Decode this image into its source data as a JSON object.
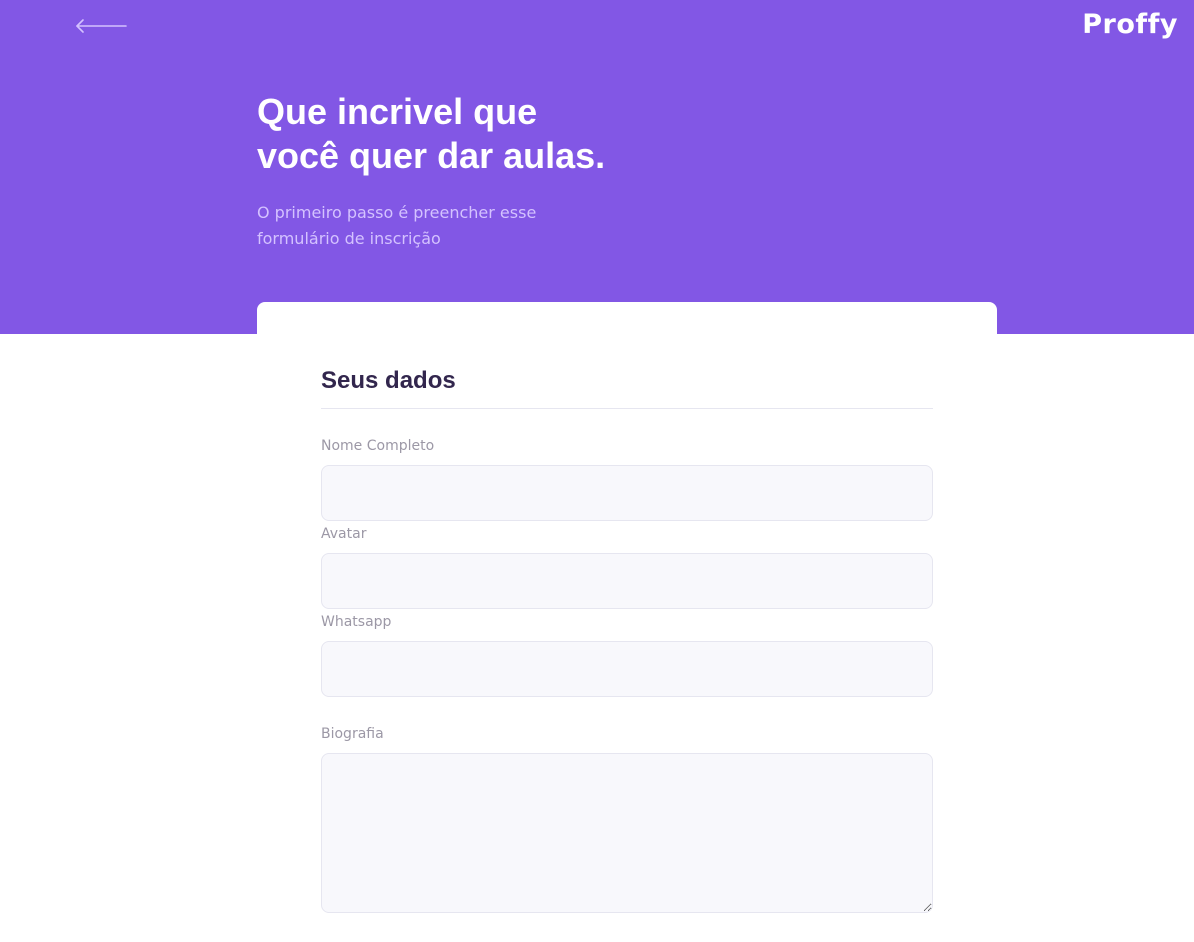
{
  "header": {
    "logo": "Proffy",
    "title_line1": "Que incrivel que",
    "title_line2": "você quer dar aulas.",
    "subtitle_line1": "O primeiro passo é preencher esse",
    "subtitle_line2": "formulário de inscrição",
    "back_icon": "arrow-left-icon",
    "background_color": "#8257e5"
  },
  "form": {
    "fieldset_title": "Seus dados",
    "fields": [
      {
        "label": "Nome Completo",
        "value": ""
      },
      {
        "label": "Avatar",
        "value": ""
      },
      {
        "label": "Whatsapp",
        "value": ""
      },
      {
        "label": "Biografia",
        "value": ""
      }
    ]
  }
}
